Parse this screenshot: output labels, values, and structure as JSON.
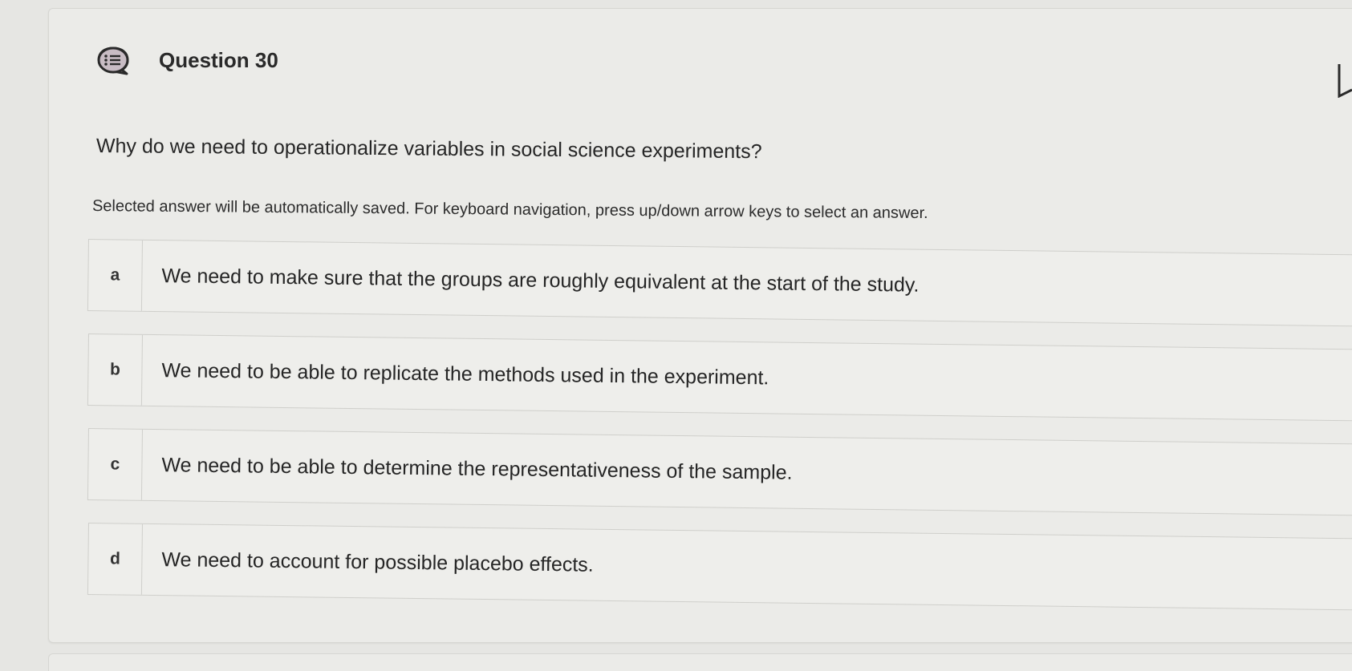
{
  "question": {
    "icon": "question-list-icon",
    "title": "Question 30",
    "text": "Why do we need to operationalize variables in social science experiments?",
    "instructions": "Selected answer will be automatically saved. For keyboard navigation, press up/down arrow keys to select an answer."
  },
  "options": [
    {
      "letter": "a",
      "text": "We need to make sure that the groups are roughly equivalent at the start of the study."
    },
    {
      "letter": "b",
      "text": "We need to be able to replicate the methods used in the experiment."
    },
    {
      "letter": "c",
      "text": "We need to be able to determine the representativeness of the sample."
    },
    {
      "letter": "d",
      "text": "We need to account for possible placebo effects."
    }
  ],
  "colors": {
    "icon_fill": "#c8bcc4",
    "icon_stroke": "#2a2a2a"
  }
}
